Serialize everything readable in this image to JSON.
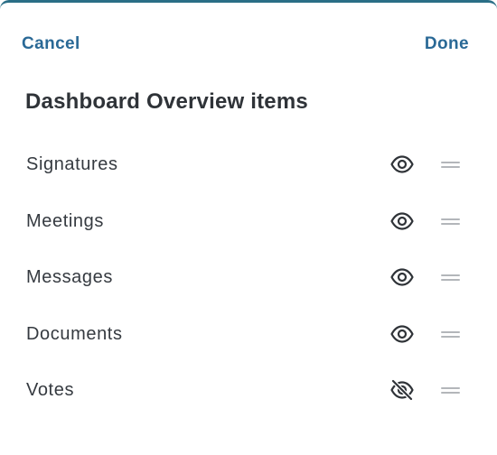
{
  "header": {
    "cancel_label": "Cancel",
    "done_label": "Done"
  },
  "title": "Dashboard Overview items",
  "items": [
    {
      "label": "Signatures",
      "visibility_icon": "eye-icon",
      "visible": true
    },
    {
      "label": "Meetings",
      "visibility_icon": "eye-icon",
      "visible": true
    },
    {
      "label": "Messages",
      "visibility_icon": "eye-icon",
      "visible": true
    },
    {
      "label": "Documents",
      "visibility_icon": "eye-icon",
      "visible": true
    },
    {
      "label": "Votes",
      "visibility_icon": "eye-off-icon",
      "visible": false
    }
  ],
  "colors": {
    "accent": "#2a6996",
    "top_border": "#2a6e86",
    "text": "#353a40",
    "handle": "#b3b6ba"
  }
}
